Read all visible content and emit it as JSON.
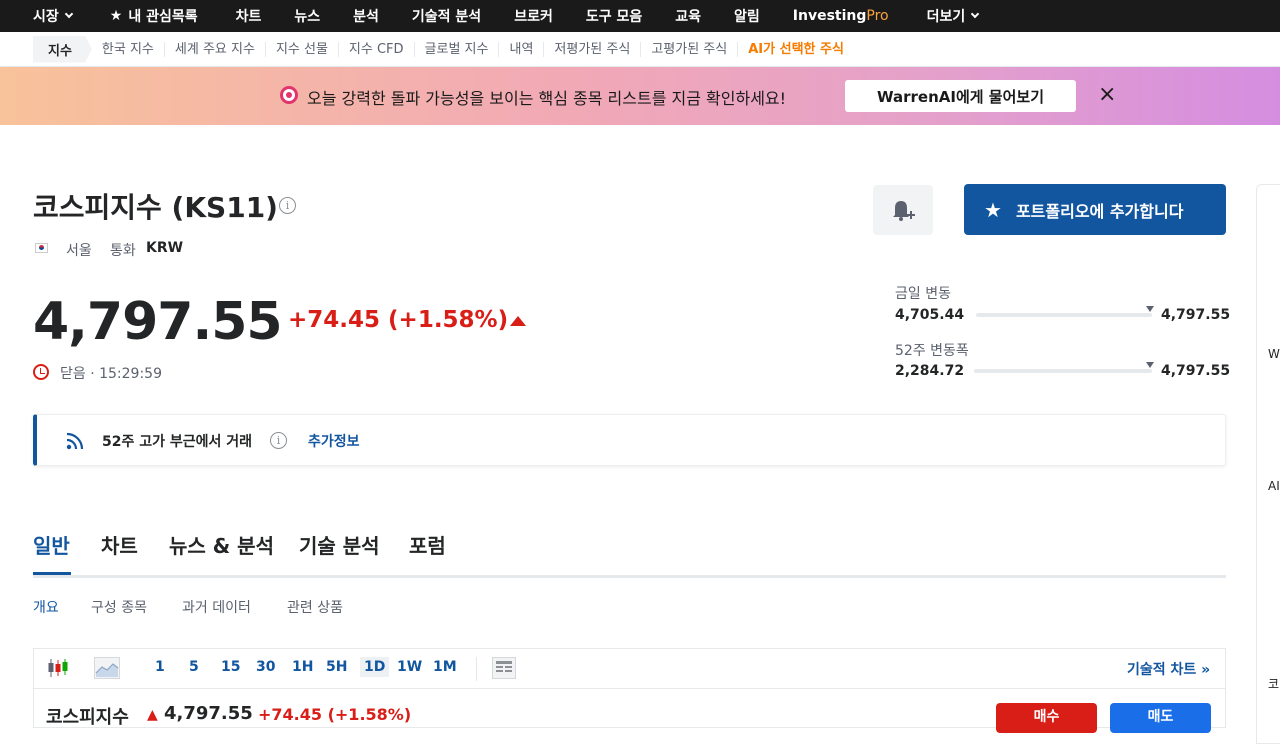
{
  "topnav": {
    "markets": "시장",
    "watchlist": "내 관심목록",
    "charts": "차트",
    "news": "뉴스",
    "analysis": "분석",
    "technical": "기술적 분석",
    "brokers": "브로커",
    "tools": "도구 모음",
    "education": "교육",
    "alerts": "알림",
    "pro_a": "Investing",
    "pro_b": "Pro",
    "more": "더보기"
  },
  "subnav": {
    "active": "지수",
    "items": [
      "한국 지수",
      "세계 주요 지수",
      "지수 선물",
      "지수 CFD",
      "글로벌 지수",
      "내역",
      "저평가된 주식",
      "고평가된 주식",
      "AI가 선택한 주식"
    ]
  },
  "banner": {
    "message": "오늘 강력한 돌파 가능성을 보이는 핵심 종목 리스트를 지금 확인하세요!",
    "button": "WarrenAI에게 물어보기",
    "close": "×"
  },
  "instrument": {
    "name": "코스피지수 (KS11)",
    "exchange": "서울",
    "currency_label": "통화",
    "currency": "KRW",
    "price": "4,797.55",
    "change": "+74.45 (+1.58%)",
    "status": "닫음 · 15:29:59"
  },
  "actions": {
    "add_portfolio": "포트폴리오에 추가합니다"
  },
  "ranges": {
    "day_label": "금일 변동",
    "day_low": "4,705.44",
    "day_high": "4,797.55",
    "week52_label": "52주 변동폭",
    "week52_low": "2,284.72",
    "week52_high": "4,797.55"
  },
  "alert": {
    "text": "52주 고가 부근에서 거래",
    "more": "추가정보"
  },
  "tabs": [
    "일반",
    "차트",
    "뉴스 & 분석",
    "기술 분석",
    "포럼"
  ],
  "subtabs": [
    "개요",
    "구성 종목",
    "과거 데이터",
    "관련 상품"
  ],
  "chart_toolbar": {
    "intervals": [
      "1",
      "5",
      "15",
      "30",
      "1H",
      "5H",
      "1D",
      "1W",
      "1M"
    ],
    "selected": "1D",
    "tech_link": "기술적 차트 »"
  },
  "chart_header": {
    "name": "코스피지수",
    "price": "4,797.55",
    "change": "+74.45 (+1.58%)",
    "sell": "매수",
    "buy": "매도"
  },
  "right_panel": {
    "items": [
      "W",
      "AI",
      "코"
    ]
  },
  "colors": {
    "accent": "#1256a0",
    "up": "#d91e18"
  }
}
